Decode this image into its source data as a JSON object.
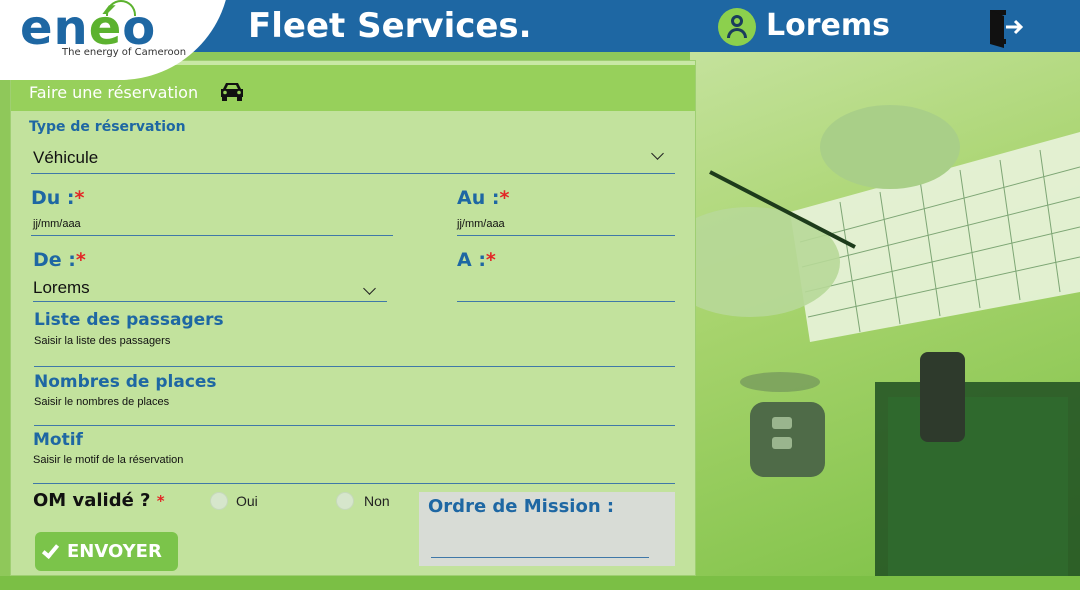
{
  "header": {
    "logo_word_1": "en",
    "logo_word_2": "é",
    "logo_word_3": "o",
    "logo_tagline": "The energy of Cameroon",
    "app_title": "Fleet Services.",
    "user_name": "Lorems"
  },
  "form": {
    "title": "Faire une réservation",
    "reservation_type": {
      "label": "Type de réservation",
      "value": "Véhicule"
    },
    "date_from": {
      "label": "Du :",
      "required_mark": "*",
      "placeholder": "jj/mm/aaa"
    },
    "date_to": {
      "label": "Au :",
      "required_mark": "*",
      "placeholder": "jj/mm/aaa"
    },
    "origin": {
      "label": "De :",
      "required_mark": "*",
      "value": "Lorems"
    },
    "destination": {
      "label": "A :",
      "required_mark": "*",
      "value": ""
    },
    "passengers": {
      "label": "Liste des passagers",
      "placeholder": "Saisir la liste des passagers"
    },
    "seats": {
      "label": "Nombres de places",
      "placeholder": "Saisir le nombres de places"
    },
    "motive": {
      "label": "Motif",
      "placeholder": "Saisir le motif de la réservation"
    },
    "om_validated": {
      "label": "OM validé ?",
      "required_mark": "*",
      "options": [
        "Oui",
        "Non"
      ]
    },
    "mission_order": {
      "label": "Ordre de Mission :"
    },
    "submit_label": "ENVOYER"
  },
  "colors": {
    "header_bg": "#1e67a3",
    "accent_green": "#7bc44a",
    "card_bg": "#c2e29d",
    "label_blue": "#1e67a3",
    "required_red": "#e32626"
  }
}
